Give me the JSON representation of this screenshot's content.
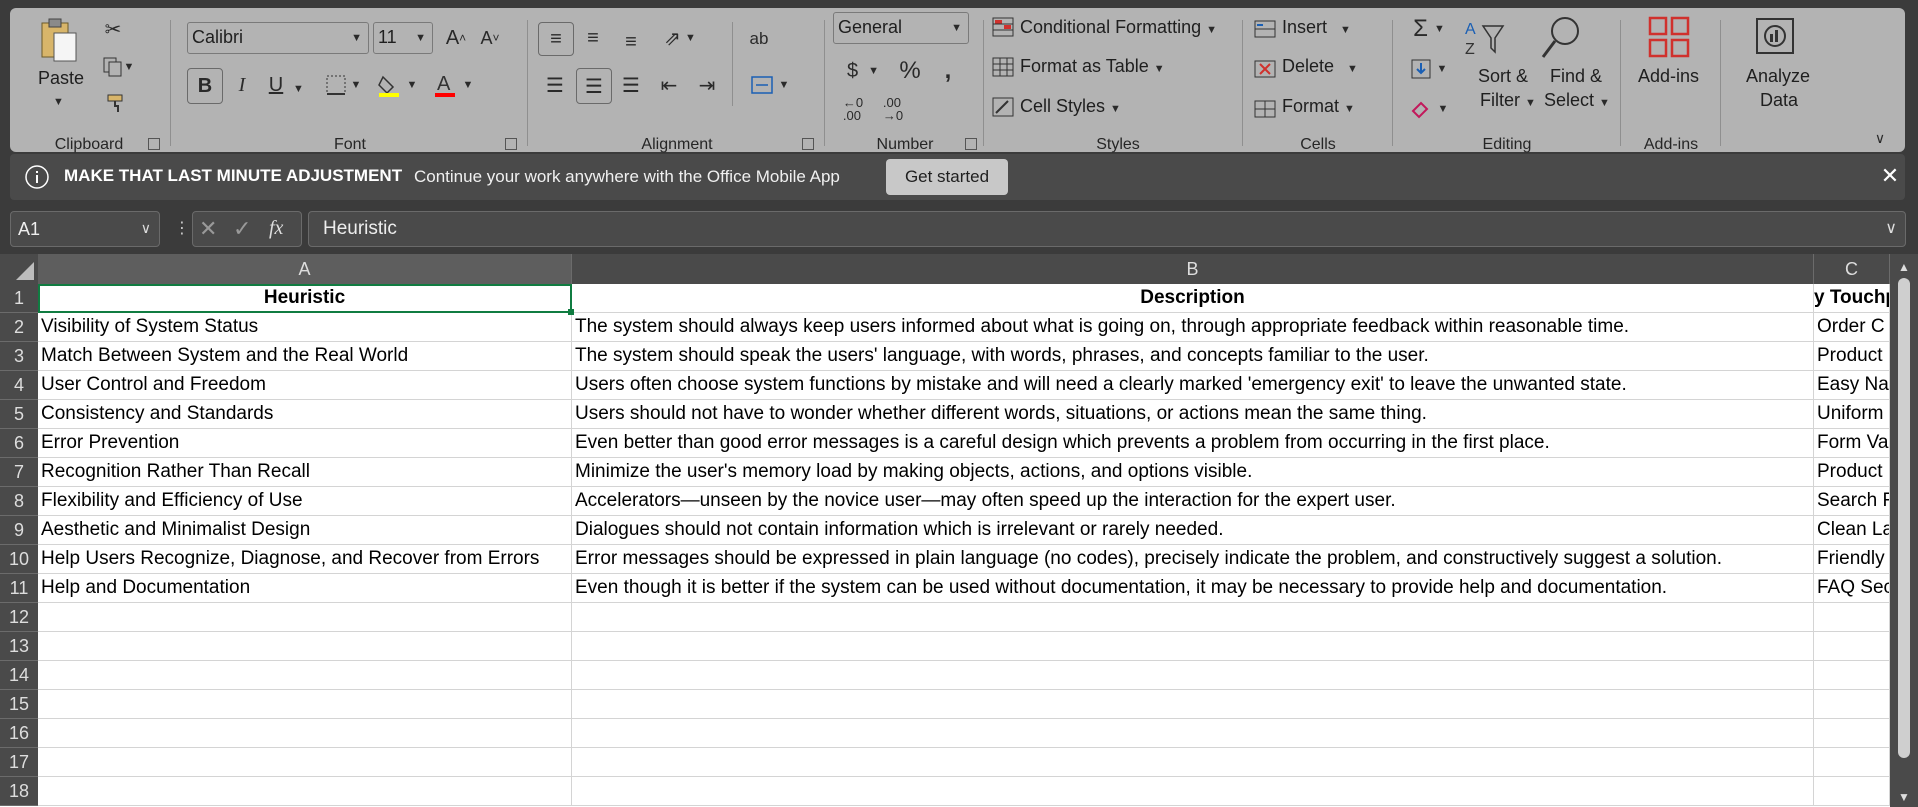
{
  "ribbon": {
    "clipboard": {
      "paste": "Paste",
      "group": "Clipboard"
    },
    "font": {
      "name": "Calibri",
      "size": "11",
      "group": "Font"
    },
    "alignment": {
      "group": "Alignment"
    },
    "number": {
      "format": "General",
      "group": "Number"
    },
    "styles": {
      "conditional": "Conditional Formatting",
      "table": "Format as Table",
      "cell_styles": "Cell Styles",
      "group": "Styles"
    },
    "cells": {
      "insert": "Insert",
      "delete": "Delete",
      "format": "Format",
      "group": "Cells"
    },
    "editing": {
      "sort": "Sort &",
      "sort2": "Filter",
      "find": "Find &",
      "find2": "Select",
      "group": "Editing"
    },
    "addins": {
      "label": "Add-ins",
      "group": "Add-ins"
    },
    "analyze": {
      "label1": "Analyze",
      "label2": "Data"
    }
  },
  "infobar": {
    "title": "MAKE THAT LAST MINUTE ADJUSTMENT",
    "message": "Continue your work anywhere with the Office Mobile App",
    "button": "Get started"
  },
  "formula": {
    "cell_ref": "A1",
    "content": "Heuristic",
    "fx": "fx"
  },
  "sheet": {
    "columns": [
      "A",
      "B",
      "C"
    ],
    "rows": [
      "1",
      "2",
      "3",
      "4",
      "5",
      "6",
      "7",
      "8",
      "9",
      "10",
      "11",
      "12",
      "13",
      "14",
      "15",
      "16",
      "17",
      "18"
    ],
    "header": {
      "a": "Heuristic",
      "b": "Description",
      "c": "y Touchp"
    },
    "data": [
      {
        "a": "Visibility of System Status",
        "b": "The system should always keep users informed about what is going on, through appropriate feedback within reasonable time.",
        "c": "Order C"
      },
      {
        "a": "Match Between System and the Real World",
        "b": "The system should speak the users' language, with words, phrases, and concepts familiar to the user.",
        "c": "Product"
      },
      {
        "a": "User Control and Freedom",
        "b": "Users often choose system functions by mistake and will need a clearly marked 'emergency exit' to leave the unwanted state.",
        "c": "Easy Na"
      },
      {
        "a": "Consistency and Standards",
        "b": "Users should not have to wonder whether different words, situations, or actions mean the same thing.",
        "c": "Uniform"
      },
      {
        "a": "Error Prevention",
        "b": "Even better than good error messages is a careful design which prevents a problem from occurring in the first place.",
        "c": "Form Va"
      },
      {
        "a": "Recognition Rather Than Recall",
        "b": "Minimize the user's memory load by making objects, actions, and options visible.",
        "c": "Product"
      },
      {
        "a": "Flexibility and Efficiency of Use",
        "b": "Accelerators—unseen by the novice user—may often speed up the interaction for the expert user.",
        "c": "Search F"
      },
      {
        "a": "Aesthetic and Minimalist Design",
        "b": "Dialogues should not contain information which is irrelevant or rarely needed.",
        "c": "Clean La"
      },
      {
        "a": "Help Users Recognize, Diagnose, and Recover from Errors",
        "b": "Error messages should be expressed in plain language (no codes), precisely indicate the problem, and constructively suggest a solution.",
        "c": "Friendly"
      },
      {
        "a": "Help and Documentation",
        "b": "Even though it is better if the system can be used without documentation, it may be necessary to provide help and documentation.",
        "c": "FAQ Sec"
      }
    ]
  }
}
